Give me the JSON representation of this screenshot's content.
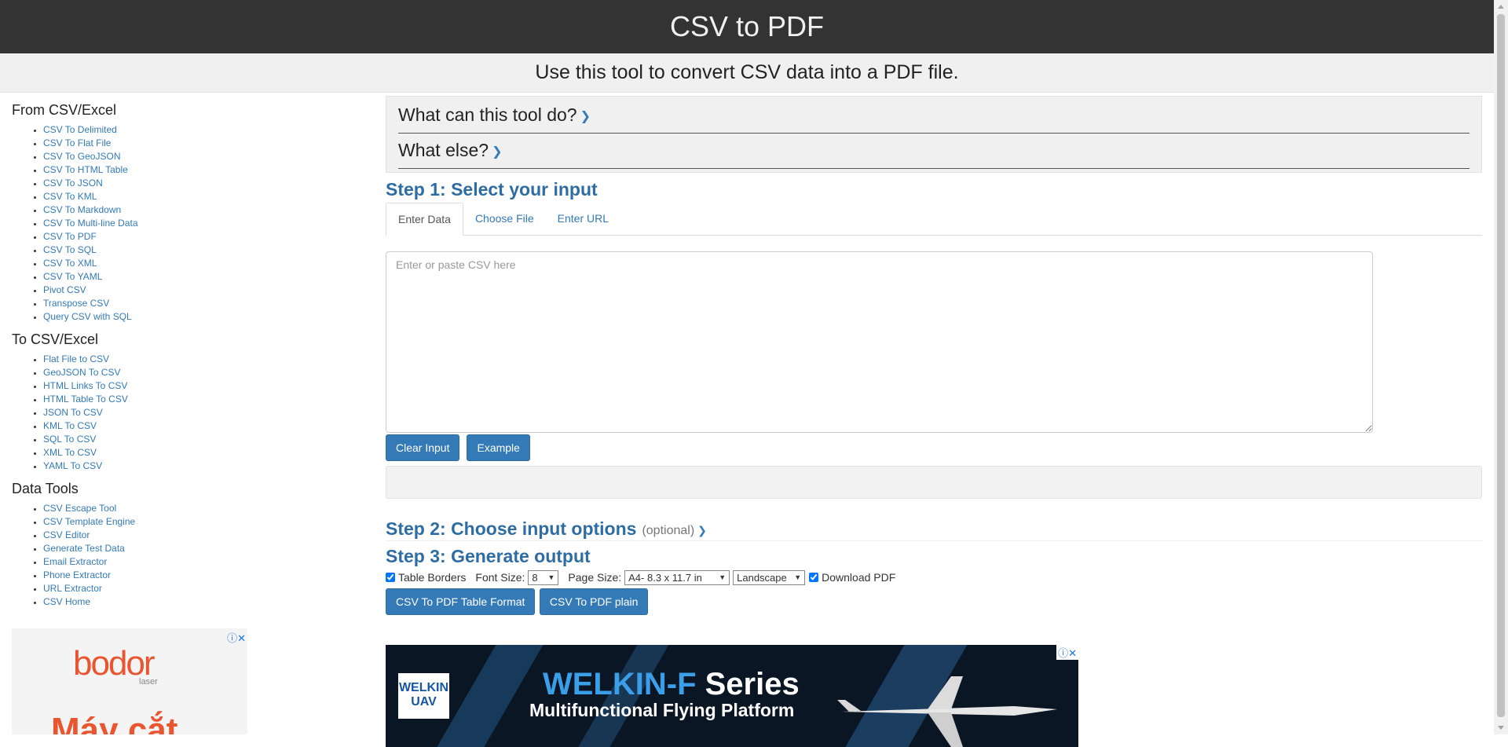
{
  "header": {
    "title": "CSV to PDF",
    "subtitle": "Use this tool to convert CSV data into a PDF file."
  },
  "sidebar": {
    "sections": [
      {
        "heading": "From CSV/Excel",
        "items": [
          "CSV To Delimited",
          "CSV To Flat File",
          "CSV To GeoJSON",
          "CSV To HTML Table",
          "CSV To JSON",
          "CSV To KML",
          "CSV To Markdown",
          "CSV To Multi-line Data",
          "CSV To PDF",
          "CSV To SQL",
          "CSV To XML",
          "CSV To YAML",
          "Pivot CSV",
          "Transpose CSV",
          "Query CSV with SQL"
        ]
      },
      {
        "heading": "To CSV/Excel",
        "items": [
          "Flat File to CSV",
          "GeoJSON To CSV",
          "HTML Links To CSV",
          "HTML Table To CSV",
          "JSON To CSV",
          "KML To CSV",
          "SQL To CSV",
          "XML To CSV",
          "YAML To CSV"
        ]
      },
      {
        "heading": "Data Tools",
        "items": [
          "CSV Escape Tool",
          "CSV Template Engine",
          "CSV Editor",
          "Generate Test Data",
          "Email Extractor",
          "Phone Extractor",
          "URL Extractor",
          "CSV Home"
        ]
      }
    ]
  },
  "faq": {
    "q1": "What can this tool do?",
    "q2": "What else?"
  },
  "step1": {
    "title": "Step 1: Select your input",
    "tabs": [
      "Enter Data",
      "Choose File",
      "Enter URL"
    ],
    "placeholder": "Enter or paste CSV here",
    "clear_label": "Clear Input",
    "example_label": "Example"
  },
  "step2": {
    "title": "Step 2: Choose input options",
    "optional": "(optional)"
  },
  "step3": {
    "title": "Step 3: Generate output",
    "table_borders_label": "Table Borders",
    "font_size_label": "Font Size:",
    "font_size_value": "8",
    "page_size_label": "Page Size:",
    "page_size_value": "A4- 8.3 x 11.7 in",
    "orientation_value": "Landscape",
    "download_label": "Download PDF",
    "table_format_button": "CSV To PDF Table Format",
    "plain_button": "CSV To PDF plain"
  },
  "ads": {
    "left_logo": "bodor",
    "left_logo_sub": "laser",
    "left_headline": "Máy cắt",
    "main_brand": "WELKIN UAV",
    "main_title_blue": "WELKIN-F",
    "main_title_white": " Series",
    "main_subtitle": "Multifunctional Flying Platform",
    "close_icon_text": "ⓘ✕"
  },
  "colors": {
    "header_bg": "#333333",
    "link": "#337ab7",
    "button": "#337ab7",
    "step_title": "#2e6da4"
  }
}
